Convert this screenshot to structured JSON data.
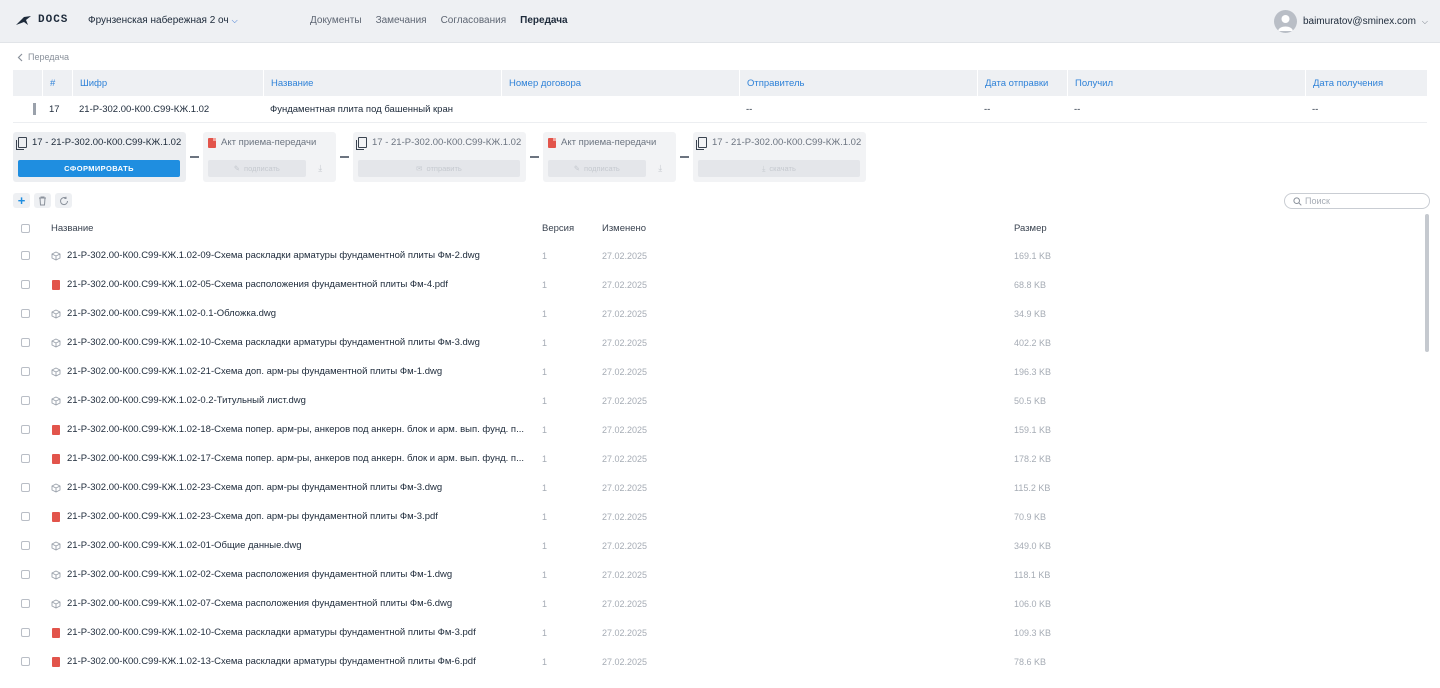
{
  "app": {
    "logo_text": "DOCS",
    "project": "Фрунзенская набережная 2 оч",
    "nav": [
      "Документы",
      "Замечания",
      "Согласования",
      "Передача"
    ],
    "active_nav": "Передача",
    "user": "baimuratov@sminex.com"
  },
  "breadcrumb": {
    "label": "Передача"
  },
  "transfer_table": {
    "headers": [
      "#",
      "Шифр",
      "Название",
      "Номер договора",
      "Отправитель",
      "Дата отправки",
      "Получил",
      "Дата получения"
    ],
    "row": {
      "num": "17",
      "code": "21-Р-302.00-К00.С99-КЖ.1.02",
      "name": "Фундаментная плита под башенный кран",
      "contract": "",
      "sender": "--",
      "sent_date": "--",
      "received_by": "--",
      "received_date": "--"
    }
  },
  "steps": [
    {
      "title": "17 - 21-Р-302.00-К00.С99-КЖ.1.02",
      "action": "СФОРМИРОВАТЬ"
    },
    {
      "title": "Акт приема-передачи",
      "action": "подписать"
    },
    {
      "title": "17 - 21-Р-302.00-К00.С99-КЖ.1.02",
      "action": "отправить"
    },
    {
      "title": "Акт приема-передачи",
      "action": "подписать"
    },
    {
      "title": "17 - 21-Р-302.00-К00.С99-КЖ.1.02",
      "action": "скачать"
    }
  ],
  "toolbar": {
    "search_placeholder": "Поиск"
  },
  "files": {
    "headers": {
      "name": "Название",
      "version": "Версия",
      "modified": "Изменено",
      "size": "Размер"
    },
    "rows": [
      {
        "type": "dwg",
        "name": "21-Р-302.00-К00.С99-КЖ.1.02-09-Схема раскладки арматуры фундаментной плиты Фм-2.dwg",
        "version": "1",
        "modified": "27.02.2025",
        "size": "169.1 KB"
      },
      {
        "type": "pdf",
        "name": "21-Р-302.00-К00.С99-КЖ.1.02-05-Схема расположения фундаментной плиты Фм-4.pdf",
        "version": "1",
        "modified": "27.02.2025",
        "size": "68.8 KB"
      },
      {
        "type": "dwg",
        "name": "21-Р-302.00-К00.С99-КЖ.1.02-0.1-Обложка.dwg",
        "version": "1",
        "modified": "27.02.2025",
        "size": "34.9 KB"
      },
      {
        "type": "dwg",
        "name": "21-Р-302.00-К00.С99-КЖ.1.02-10-Схема раскладки арматуры фундаментной плиты Фм-3.dwg",
        "version": "1",
        "modified": "27.02.2025",
        "size": "402.2 KB"
      },
      {
        "type": "dwg",
        "name": "21-Р-302.00-К00.С99-КЖ.1.02-21-Схема доп. арм-ры фундаментной плиты Фм-1.dwg",
        "version": "1",
        "modified": "27.02.2025",
        "size": "196.3 KB"
      },
      {
        "type": "dwg",
        "name": "21-Р-302.00-К00.С99-КЖ.1.02-0.2-Титульный лист.dwg",
        "version": "1",
        "modified": "27.02.2025",
        "size": "50.5 KB"
      },
      {
        "type": "pdf",
        "name": "21-Р-302.00-К00.С99-КЖ.1.02-18-Схема попер. арм-ры, анкеров под анкерн. блок и арм. вып. фунд. п...",
        "version": "1",
        "modified": "27.02.2025",
        "size": "159.1 KB"
      },
      {
        "type": "pdf",
        "name": "21-Р-302.00-К00.С99-КЖ.1.02-17-Схема попер. арм-ры, анкеров под анкерн. блок и арм. вып. фунд. п...",
        "version": "1",
        "modified": "27.02.2025",
        "size": "178.2 KB"
      },
      {
        "type": "dwg",
        "name": "21-Р-302.00-К00.С99-КЖ.1.02-23-Схема доп. арм-ры фундаментной плиты Фм-3.dwg",
        "version": "1",
        "modified": "27.02.2025",
        "size": "115.2 KB"
      },
      {
        "type": "pdf",
        "name": "21-Р-302.00-К00.С99-КЖ.1.02-23-Схема доп. арм-ры фундаментной плиты Фм-3.pdf",
        "version": "1",
        "modified": "27.02.2025",
        "size": "70.9 KB"
      },
      {
        "type": "dwg",
        "name": "21-Р-302.00-К00.С99-КЖ.1.02-01-Общие данные.dwg",
        "version": "1",
        "modified": "27.02.2025",
        "size": "349.0 KB"
      },
      {
        "type": "dwg",
        "name": "21-Р-302.00-К00.С99-КЖ.1.02-02-Схема расположения фундаментной плиты Фм-1.dwg",
        "version": "1",
        "modified": "27.02.2025",
        "size": "118.1 KB"
      },
      {
        "type": "dwg",
        "name": "21-Р-302.00-К00.С99-КЖ.1.02-07-Схема расположения фундаментной плиты Фм-6.dwg",
        "version": "1",
        "modified": "27.02.2025",
        "size": "106.0 KB"
      },
      {
        "type": "pdf",
        "name": "21-Р-302.00-К00.С99-КЖ.1.02-10-Схема раскладки арматуры фундаментной плиты Фм-3.pdf",
        "version": "1",
        "modified": "27.02.2025",
        "size": "109.3 KB"
      },
      {
        "type": "pdf",
        "name": "21-Р-302.00-К00.С99-КЖ.1.02-13-Схема раскладки арматуры фундаментной плиты Фм-6.pdf",
        "version": "1",
        "modified": "27.02.2025",
        "size": "78.6 KB"
      }
    ]
  },
  "colors": {
    "accent": "#1f8ee0",
    "header_link": "#2f82d8",
    "pdf": "#e2544b",
    "topbar": "#eef0f3"
  }
}
